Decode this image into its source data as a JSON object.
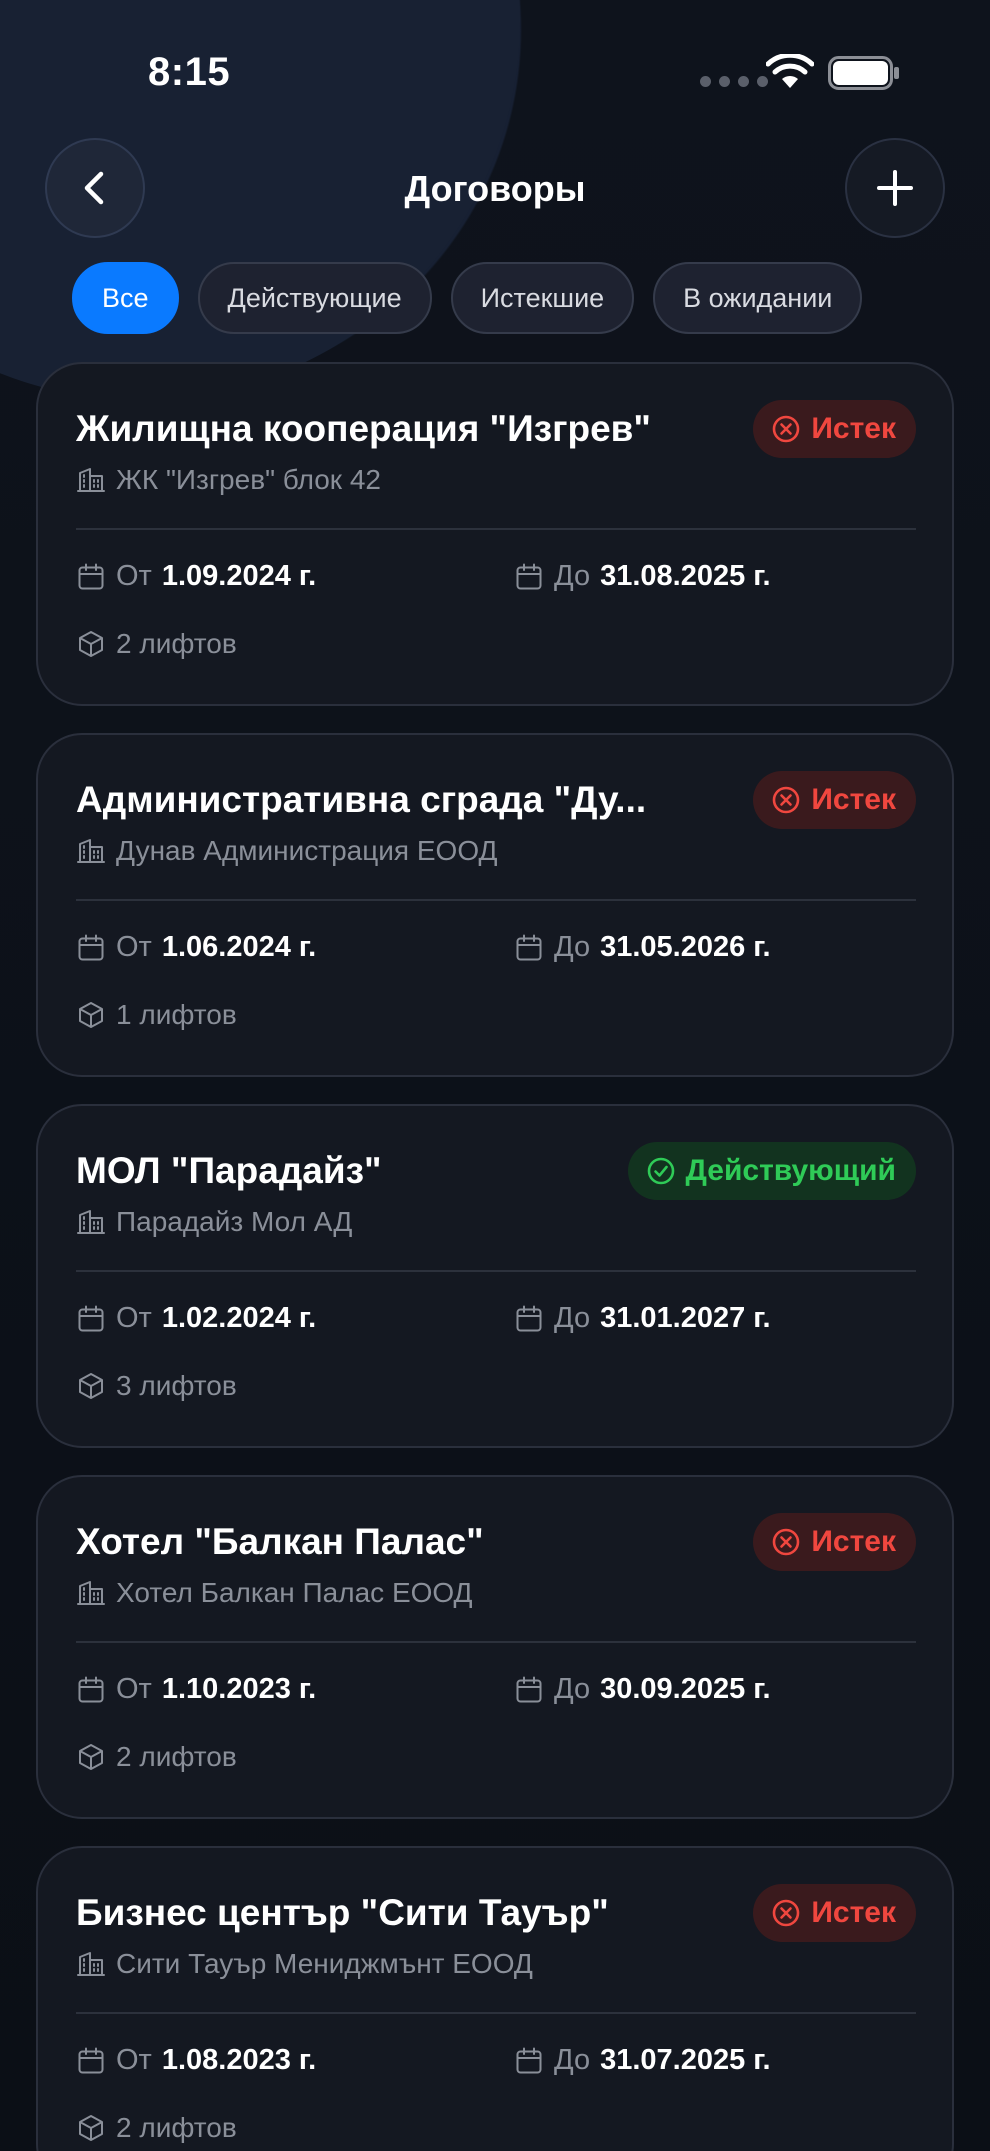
{
  "status_bar": {
    "time": "8:15"
  },
  "header": {
    "title": "Договоры"
  },
  "filters": [
    {
      "label": "Все",
      "active": true
    },
    {
      "label": "Действующие",
      "active": false
    },
    {
      "label": "Истекшие",
      "active": false
    },
    {
      "label": "В ожидании",
      "active": false
    }
  ],
  "labels": {
    "from": "От",
    "to": "До"
  },
  "colors": {
    "accent": "#0a7aff",
    "expired": "#f0473f",
    "active": "#2fcb57"
  },
  "contracts": [
    {
      "title": "Жилищна кооперация \"Изгрев\"",
      "status": "Истек",
      "status_type": "expired",
      "company": "ЖК \"Изгрев\" блок 42",
      "from": "1.09.2024 г.",
      "to": "31.08.2025 г.",
      "lifts": "2 лифтов"
    },
    {
      "title": "Административна сграда \"Ду...",
      "status": "Истек",
      "status_type": "expired",
      "company": "Дунав Администрация ЕООД",
      "from": "1.06.2024 г.",
      "to": "31.05.2026 г.",
      "lifts": "1 лифтов"
    },
    {
      "title": "МОЛ \"Парадайз\"",
      "status": "Действующий",
      "status_type": "active",
      "company": "Парадайз Мол АД",
      "from": "1.02.2024 г.",
      "to": "31.01.2027 г.",
      "lifts": "3 лифтов"
    },
    {
      "title": "Хотел \"Балкан Палас\"",
      "status": "Истек",
      "status_type": "expired",
      "company": "Хотел Балкан Палас ЕООД",
      "from": "1.10.2023 г.",
      "to": "30.09.2025 г.",
      "lifts": "2 лифтов"
    },
    {
      "title": "Бизнес център \"Сити Тауър\"",
      "status": "Истек",
      "status_type": "expired",
      "company": "Сити Тауър Мениджмънт ЕООД",
      "from": "1.08.2023 г.",
      "to": "31.07.2025 г.",
      "lifts": "2 лифтов"
    }
  ]
}
